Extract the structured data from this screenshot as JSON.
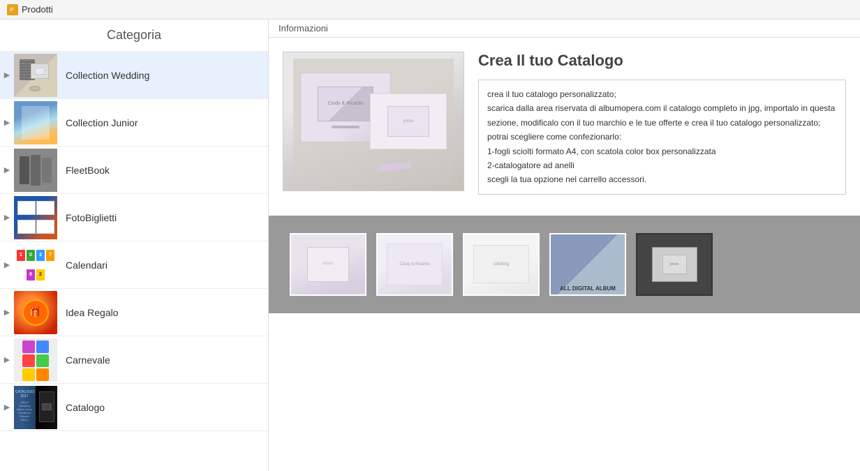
{
  "app": {
    "title": "Prodotti",
    "info_tab": "Informazioni"
  },
  "sidebar": {
    "header": "Categoria",
    "items": [
      {
        "id": "wedding",
        "label": "Collection Wedding",
        "active": true
      },
      {
        "id": "junior",
        "label": "Collection Junior",
        "active": false
      },
      {
        "id": "fleet",
        "label": "FleetBook",
        "active": false
      },
      {
        "id": "foto",
        "label": "FotoBiglietti",
        "active": false
      },
      {
        "id": "cal",
        "label": "Calendari",
        "active": false
      },
      {
        "id": "idea",
        "label": "Idea Regalo",
        "active": false
      },
      {
        "id": "carnev",
        "label": "Carnevale",
        "active": false
      },
      {
        "id": "catalog",
        "label": "Catalogo",
        "active": false
      }
    ]
  },
  "content": {
    "title": "Crea Il tuo Catalogo",
    "description_lines": [
      "crea il tuo catalogo personalizzato;",
      "scarica dalla area riservata di albumopera.com il catalogo completo in jpg, importalo in questa sezione, modificalo con il tuo marchio e le tue offerte e  crea il tuo catalogo personalizzato;",
      "potrai scegliere come confezionarlo:",
      "1-fogli sciolti formato A4, con scatola color box personalizzata",
      "2-catalogatore ad anelli",
      "scegli la tua opzione nel carrello accessori."
    ],
    "thumbnails": [
      {
        "id": "t1",
        "label": ""
      },
      {
        "id": "t2",
        "label": ""
      },
      {
        "id": "t3",
        "label": ""
      },
      {
        "id": "t4",
        "label": "ALL DIGITAL ALBUM"
      },
      {
        "id": "t5",
        "label": "",
        "selected": true
      }
    ]
  }
}
